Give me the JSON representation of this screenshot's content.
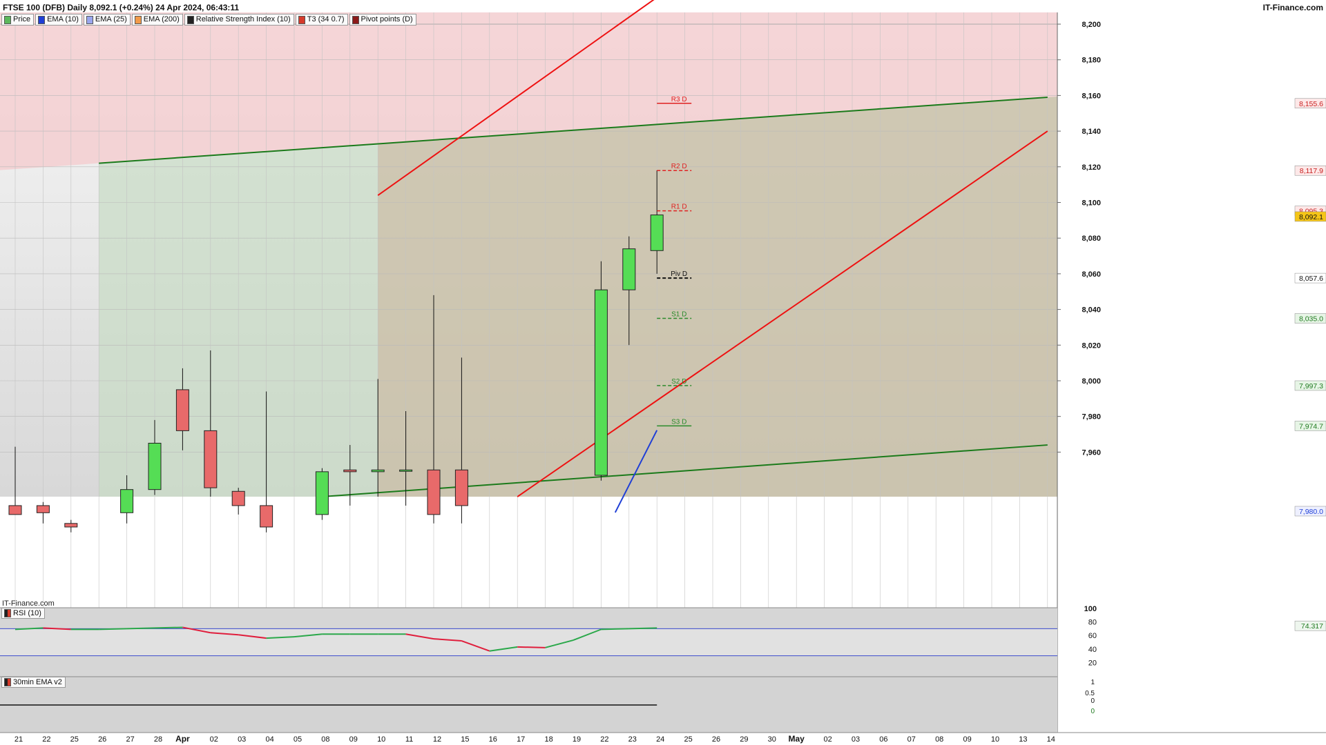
{
  "header": {
    "title": "FTSE 100 (DFB) Daily 8,092.1 (+0.24%) 24 Apr 2024, 06:43:11",
    "brand": "IT-Finance.com"
  },
  "legend": [
    {
      "label": "Price",
      "color": "#5cb85c"
    },
    {
      "label": "EMA (10)",
      "color": "#1f3fd6"
    },
    {
      "label": "EMA (25)",
      "color": "#9aa6ee"
    },
    {
      "label": "EMA (200)",
      "color": "#f29a4a"
    },
    {
      "label": "Relative Strength Index (10)",
      "color": "#222222"
    },
    {
      "label": "T3 (34 0.7)",
      "color": "#d63a2a"
    },
    {
      "label": "Pivot points (D)",
      "color": "#8b1a1a"
    }
  ],
  "watermark": "IT-Finance.com",
  "rsi_panel": {
    "label": "RSI (10)",
    "ticks": [
      "100",
      "80",
      "60",
      "40",
      "20"
    ],
    "value": "74.317"
  },
  "ema30_panel": {
    "label": "30min EMA v2",
    "ticks": [
      "1",
      "0.5",
      "0",
      "0"
    ]
  },
  "colors": {
    "up": "#55dd55",
    "down": "#e86a6a",
    "pivot_res": "#e02020",
    "pivot_sup": "#2a8a2a",
    "trend_red": "#ee1111",
    "trend_green": "#1a7a1a",
    "ema10": "#1f3fd6"
  },
  "chart_data": {
    "type": "candlestick",
    "title": "FTSE 100 (DFB) Daily",
    "ylim": [
      7935,
      8215
    ],
    "y_ticks": [
      7960,
      7980,
      8000,
      8020,
      8040,
      8060,
      8080,
      8100,
      8120,
      8140,
      8160,
      8180,
      8200
    ],
    "x_labels": [
      "21",
      "22",
      "25",
      "26",
      "27",
      "28",
      "Apr",
      "02",
      "03",
      "04",
      "05",
      "08",
      "09",
      "10",
      "11",
      "12",
      "15",
      "16",
      "17",
      "18",
      "19",
      "22",
      "23",
      "24",
      "25",
      "26",
      "29",
      "30",
      "May",
      "02",
      "03",
      "06",
      "07",
      "08",
      "09",
      "10",
      "13",
      "14"
    ],
    "candles": [
      {
        "date": "21",
        "open": 7930,
        "high": 7963,
        "low": 7925,
        "close": 7925
      },
      {
        "date": "22",
        "open": 7930,
        "high": 7932,
        "low": 7920,
        "close": 7926
      },
      {
        "date": "25",
        "open": 7920,
        "high": 7922,
        "low": 7915,
        "close": 7918
      },
      {
        "date": "27",
        "open": 7926,
        "high": 7947,
        "low": 7920,
        "close": 7939
      },
      {
        "date": "28",
        "open": 7939,
        "high": 7978,
        "low": 7936,
        "close": 7965
      },
      {
        "date": "Apr",
        "open": 7995,
        "high": 8007,
        "low": 7961,
        "close": 7972
      },
      {
        "date": "02",
        "open": 7972,
        "high": 8017,
        "low": 7935,
        "close": 7940
      },
      {
        "date": "03",
        "open": 7938,
        "high": 7940,
        "low": 7925,
        "close": 7930
      },
      {
        "date": "04",
        "open": 7930,
        "high": 7994,
        "low": 7915,
        "close": 7918
      },
      {
        "date": "08",
        "open": 7925,
        "high": 7951,
        "low": 7922,
        "close": 7949
      },
      {
        "date": "09",
        "open": 7950,
        "high": 7964,
        "low": 7930,
        "close": 7949
      },
      {
        "date": "10",
        "open": 7949,
        "high": 8001,
        "low": 7935,
        "close": 7950
      },
      {
        "date": "11",
        "open": 7950,
        "high": 7983,
        "low": 7930,
        "close": 7950
      },
      {
        "date": "12",
        "open": 7950,
        "high": 8048,
        "low": 7920,
        "close": 7925
      },
      {
        "date": "15",
        "open": 7950,
        "high": 8013,
        "low": 7920,
        "close": 7930
      },
      {
        "date": "22",
        "open": 7947,
        "high": 8067,
        "low": 7944,
        "close": 8051
      },
      {
        "date": "23",
        "open": 8051,
        "high": 8081,
        "low": 8020,
        "close": 8074
      },
      {
        "date": "24",
        "open": 8073,
        "high": 8118,
        "low": 8060,
        "close": 8093
      }
    ],
    "pivots": [
      {
        "name": "R3 D",
        "value": 8155.6,
        "value_label": "8,155.6"
      },
      {
        "name": "R2 D",
        "value": 8117.9,
        "value_label": "8,117.9"
      },
      {
        "name": "R1 D",
        "value": 8095.3,
        "value_label": "8,095.3"
      },
      {
        "name": "Piv D",
        "value": 8057.6,
        "value_label": "8,057.6"
      },
      {
        "name": "S1 D",
        "value": 8035.0,
        "value_label": "8,035.0"
      },
      {
        "name": "S2 D",
        "value": 7997.3,
        "value_label": "7,997.3"
      },
      {
        "name": "S3 D",
        "value": 7974.7,
        "value_label": "7,974.7"
      }
    ],
    "current_price": {
      "value": 8092.1,
      "label": "8,092.1"
    },
    "ema10": {
      "points": [
        {
          "date": "23",
          "value": 7930
        },
        {
          "date": "24",
          "value": 7980
        }
      ],
      "label": "7,980.0"
    },
    "trendlines": {
      "green_upper": [
        {
          "date": "26",
          "value": 8122
        },
        {
          "date": "14",
          "value": 8159
        }
      ],
      "green_lower": [
        {
          "date": "08",
          "value": 7935
        },
        {
          "date": "14",
          "value": 7964
        }
      ],
      "red_upper": [
        {
          "date": "10",
          "value": 8104
        },
        {
          "date": "24",
          "value": 8215
        }
      ],
      "red_lower": [
        {
          "date": "17",
          "value": 7935
        },
        {
          "date": "14",
          "value": 8140
        }
      ]
    },
    "rsi": {
      "ylim": [
        0,
        100
      ],
      "dates": [
        "21",
        "22",
        "25",
        "26",
        "27",
        "28",
        "Apr",
        "02",
        "03",
        "04",
        "05",
        "08",
        "09",
        "10",
        "11",
        "12",
        "15",
        "16",
        "17",
        "18",
        "19",
        "22",
        "23",
        "24"
      ],
      "values": [
        69,
        71,
        69,
        69,
        70,
        71,
        72,
        64,
        61,
        56,
        58,
        62,
        62,
        62,
        62,
        55,
        52,
        37,
        43,
        42,
        53,
        69,
        70,
        71
      ]
    }
  }
}
